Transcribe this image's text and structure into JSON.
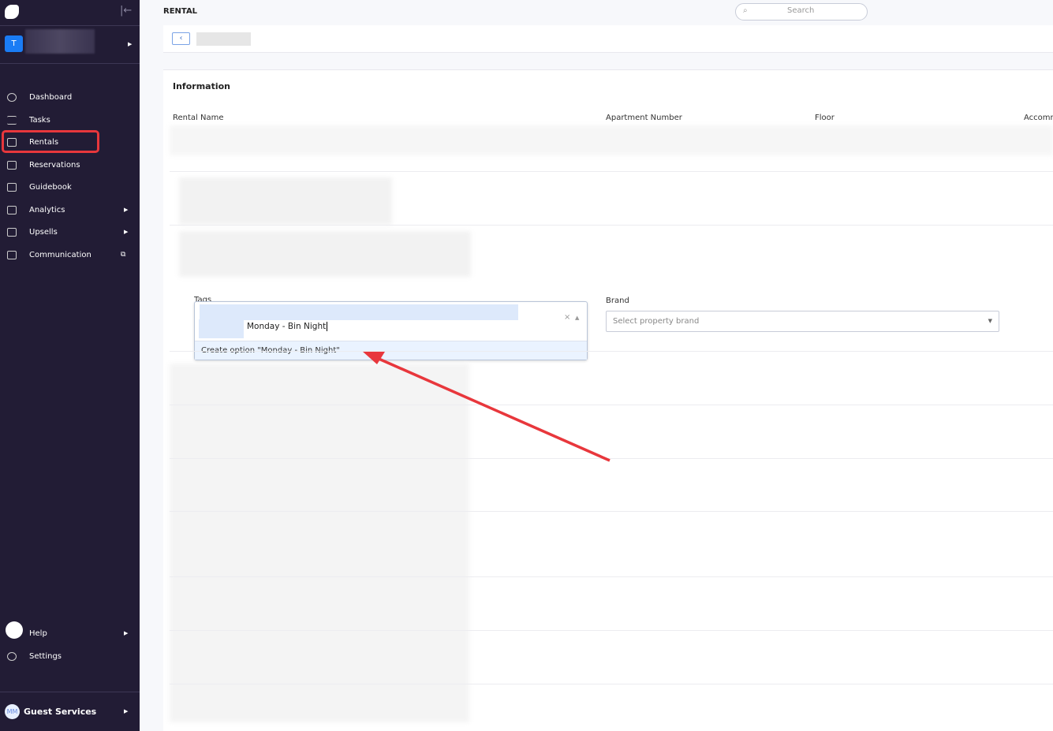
{
  "sidebar": {
    "account_initial": "T",
    "items": [
      {
        "label": "Dashboard"
      },
      {
        "label": "Tasks"
      },
      {
        "label": "Rentals"
      },
      {
        "label": "Reservations"
      },
      {
        "label": "Guidebook"
      },
      {
        "label": "Analytics"
      },
      {
        "label": "Upsells"
      },
      {
        "label": "Communication"
      }
    ],
    "help": "Help",
    "settings": "Settings",
    "user_initials": "MM",
    "user_name": "Guest Services"
  },
  "header": {
    "title": "RENTAL",
    "search_placeholder": "Search"
  },
  "card": {
    "heading": "Information",
    "columns": [
      "Rental Name",
      "Apartment Number",
      "Floor",
      "Accommodates"
    ],
    "tags_label": "Tags",
    "tags_input": "Monday - Bin Night",
    "tags_option": "Create option \"Monday - Bin Night\"",
    "brand_label": "Brand",
    "brand_placeholder": "Select property brand"
  },
  "colors": {
    "sidebar": "#221c35",
    "accent": "#1a7cf5",
    "highlight": "#e8373c"
  }
}
